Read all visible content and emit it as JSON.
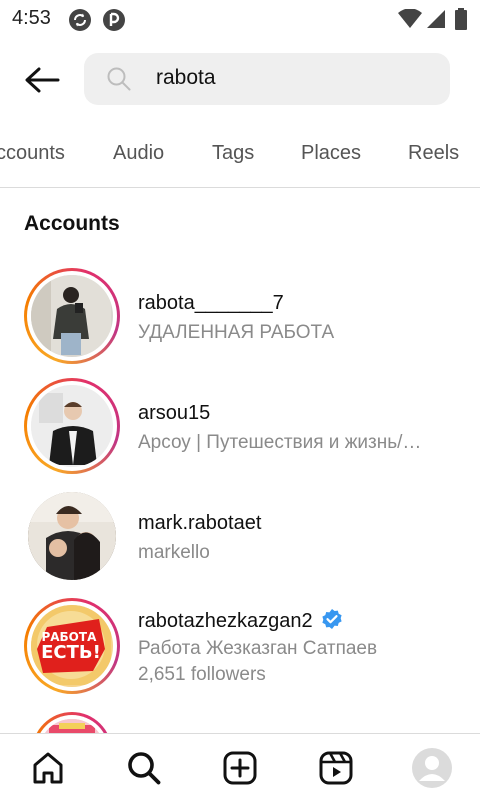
{
  "status_bar": {
    "time": "4:53"
  },
  "search": {
    "query": "rabota"
  },
  "tabs": [
    {
      "label": "ccounts"
    },
    {
      "label": "Audio"
    },
    {
      "label": "Tags"
    },
    {
      "label": "Places"
    },
    {
      "label": "Reels"
    }
  ],
  "section": {
    "title": "Accounts"
  },
  "accounts": [
    {
      "username": "rabota_______7",
      "subtitle": "УДАЛЕННАЯ РАБОТА",
      "extra": ""
    },
    {
      "username": "arsou15",
      "subtitle": "Арсоу | Путешествия и жизнь/…",
      "extra": ""
    },
    {
      "username": "mark.rabotaet",
      "subtitle": "markello",
      "extra": ""
    },
    {
      "username": "rabotazhezkazgan2",
      "subtitle": "Работа Жезказган Сатпаев",
      "extra": "2,651 followers",
      "avatar_text": "РАБОТА ЕСТЬ!"
    }
  ],
  "colors": {
    "verified": "#3897f0",
    "secondary_text": "#8a8a8a"
  }
}
